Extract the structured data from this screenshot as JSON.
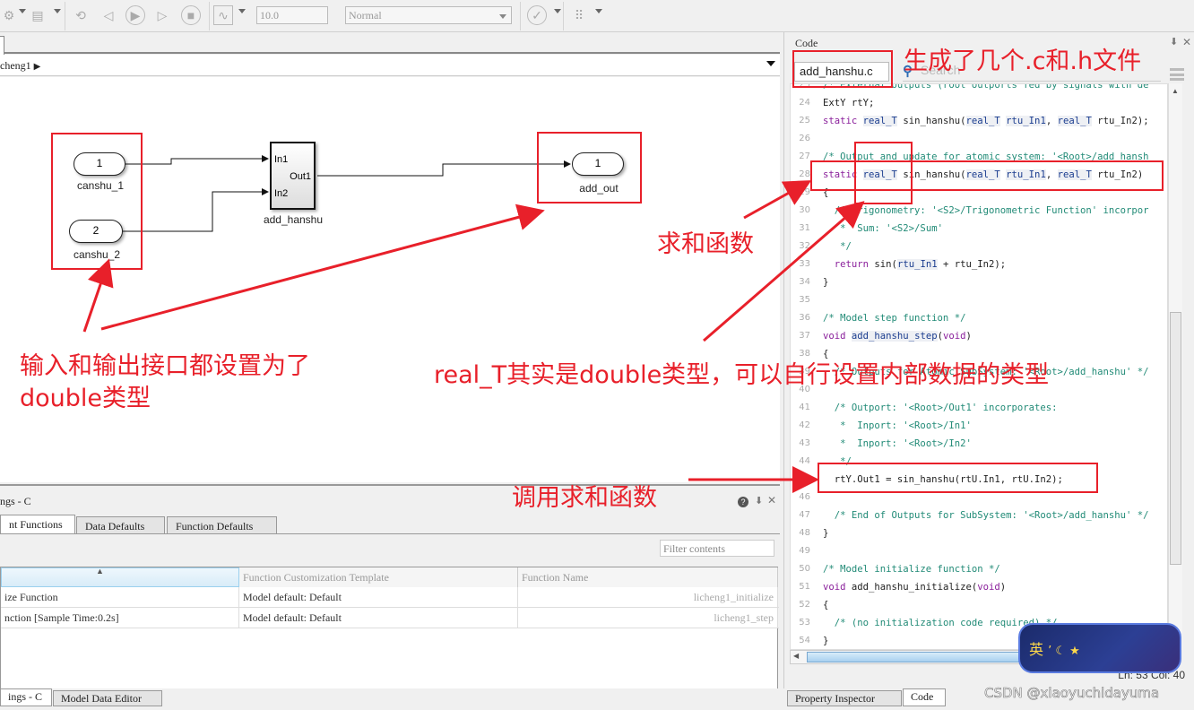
{
  "toolbar": {
    "stop_time": "10.0",
    "sim_mode": "Normal",
    "icons": [
      "settings-icon",
      "model-config-icon",
      "step-back-icon",
      "run-icon",
      "step-forward-icon",
      "stop-icon",
      "scope-icon",
      "check-icon",
      "build-icon"
    ]
  },
  "editor": {
    "breadcrumb": "cheng1"
  },
  "model": {
    "inports": [
      {
        "number": "1",
        "name": "canshu_1"
      },
      {
        "number": "2",
        "name": "canshu_2"
      }
    ],
    "subsystem": {
      "name": "add_hanshu",
      "in1": "In1",
      "in2": "In2",
      "out1": "Out1"
    },
    "outport": {
      "number": "1",
      "name": "add_out"
    }
  },
  "annotations": {
    "files_note": "生成了几个.c和.h文件",
    "sum_func_note": "求和函数",
    "io_note_line1": "输入和输出接口都设置为了",
    "io_note_line2": "double类型",
    "real_t_note": "real_T其实是double类型，可以自行设置内部数据的类型",
    "call_note": "调用求和函数"
  },
  "mapping_panel": {
    "title": "ngs - C",
    "tabs": [
      "nt Functions",
      "Data Defaults",
      "Function Defaults"
    ],
    "filter_placeholder": "Filter contents",
    "columns": [
      "",
      "Function Customization Template",
      "Function Name"
    ],
    "rows": [
      {
        "source": "ize Function",
        "template": "Model default: Default",
        "name": "licheng1_initialize"
      },
      {
        "source": "nction [Sample Time:0.2s]",
        "template": "Model default: Default",
        "name": "licheng1_step"
      }
    ]
  },
  "bottom_tabs": [
    "ings - C",
    "Model Data Editor"
  ],
  "code_panel": {
    "title": "Code",
    "file": "add_hanshu.c",
    "search_placeholder": "Search",
    "lines": [
      {
        "n": "23",
        "html": "<span class='cm'>/* External outputs (root outports fed by signals with de</span>"
      },
      {
        "n": "24",
        "html": "ExtY rtY;"
      },
      {
        "n": "25",
        "html": "<span class='kw'>static</span> <span class='hl'>real_T</span> sin_hanshu(<span class='hl'>real_T</span> <span class='hl'>rtu_In1</span>, <span class='hl'>real_T</span> rtu_In2);"
      },
      {
        "n": "26",
        "html": ""
      },
      {
        "n": "27",
        "html": "<span class='cm'>/* Output and update for atomic system: '&lt;Root&gt;/add_hansh</span>"
      },
      {
        "n": "28",
        "html": "<span class='kw'>static</span> <span class='hl'>real_T</span> sin_hanshu(<span class='hl'>real_T</span> <span class='hl'>rtu_In1</span>, <span class='hl'>real_T</span> rtu_In2)"
      },
      {
        "n": "29",
        "html": "{"
      },
      {
        "n": "30",
        "html": "  <span class='cm'>/* Trigonometry: '&lt;S2&gt;/Trigonometric Function' incorpor</span>"
      },
      {
        "n": "31",
        "html": "  <span class='cm'> *  Sum: '&lt;S2&gt;/Sum'</span>"
      },
      {
        "n": "32",
        "html": "  <span class='cm'> */</span>"
      },
      {
        "n": "33",
        "html": "  <span class='kw'>return</span> sin(<span class='hl'>rtu_In1</span> + rtu_In2);"
      },
      {
        "n": "34",
        "html": "}"
      },
      {
        "n": "35",
        "html": ""
      },
      {
        "n": "36",
        "html": "<span class='cm'>/* Model step function */</span>"
      },
      {
        "n": "37",
        "html": "<span class='kw'>void</span> <span class='hl'>add_hanshu_step</span>(<span class='kw'>void</span>)"
      },
      {
        "n": "38",
        "html": "{"
      },
      {
        "n": "39",
        "html": "  <span class='cm'>/* Outputs for Atomic SubSystem: '&lt;Root&gt;/add_hanshu' */</span>"
      },
      {
        "n": "40",
        "html": ""
      },
      {
        "n": "41",
        "html": "  <span class='cm'>/* Outport: '&lt;Root&gt;/Out1' incorporates:</span>"
      },
      {
        "n": "42",
        "html": "  <span class='cm'> *  Inport: '&lt;Root&gt;/In1'</span>"
      },
      {
        "n": "43",
        "html": "  <span class='cm'> *  Inport: '&lt;Root&gt;/In2'</span>"
      },
      {
        "n": "44",
        "html": "  <span class='cm'> */</span>"
      },
      {
        "n": "45",
        "html": "  rtY.Out1 = sin_hanshu(rtU.In1, rtU.In2);"
      },
      {
        "n": "46",
        "html": ""
      },
      {
        "n": "47",
        "html": "  <span class='cm'>/* End of Outputs for SubSystem: '&lt;Root&gt;/add_hanshu' */</span>"
      },
      {
        "n": "48",
        "html": "}"
      },
      {
        "n": "49",
        "html": ""
      },
      {
        "n": "50",
        "html": "<span class='cm'>/* Model initialize function */</span>"
      },
      {
        "n": "51",
        "html": "<span class='kw'>void</span> add_hanshu_initialize(<span class='kw'>void</span>)"
      },
      {
        "n": "52",
        "html": "{"
      },
      {
        "n": "53",
        "html": "  <span class='cm'>/* (no initialization code required) */</span>"
      },
      {
        "n": "54",
        "html": "}"
      }
    ],
    "status": "Ln: 53  Col: 40",
    "tabs": [
      "Property Inspector",
      "Code"
    ]
  },
  "ime": {
    "label": "英"
  },
  "watermark": "CSDN @xiaoyuchidayuma"
}
